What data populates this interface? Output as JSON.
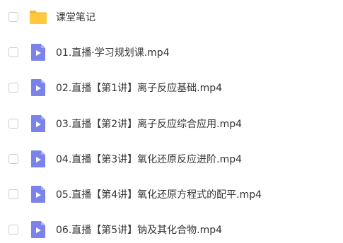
{
  "file_list": {
    "items": [
      {
        "name": "课堂笔记",
        "type": "folder",
        "icon": "folder-icon",
        "checked": false
      },
      {
        "name": "01.直播·学习规划课.mp4",
        "type": "video",
        "icon": "video-file-icon",
        "checked": false
      },
      {
        "name": "02.直播【第1讲】离子反应基础.mp4",
        "type": "video",
        "icon": "video-file-icon",
        "checked": false
      },
      {
        "name": "03.直播【第2讲】离子反应综合应用.mp4",
        "type": "video",
        "icon": "video-file-icon",
        "checked": false
      },
      {
        "name": "04.直播【第3讲】氧化还原反应进阶.mp4",
        "type": "video",
        "icon": "video-file-icon",
        "checked": false
      },
      {
        "name": "05.直播【第4讲】氧化还原方程式的配平.mp4",
        "type": "video",
        "icon": "video-file-icon",
        "checked": false
      },
      {
        "name": "06.直播【第5讲】钠及其化合物.mp4",
        "type": "video",
        "icon": "video-file-icon",
        "checked": false
      }
    ]
  },
  "colors": {
    "folder": "#FFC83D",
    "folder_tab": "#F5B82E",
    "video_file": "#7B83EB",
    "video_file_fold": "#A9AEF3",
    "text": "#333333",
    "checkbox_border": "#C9CCD2"
  }
}
